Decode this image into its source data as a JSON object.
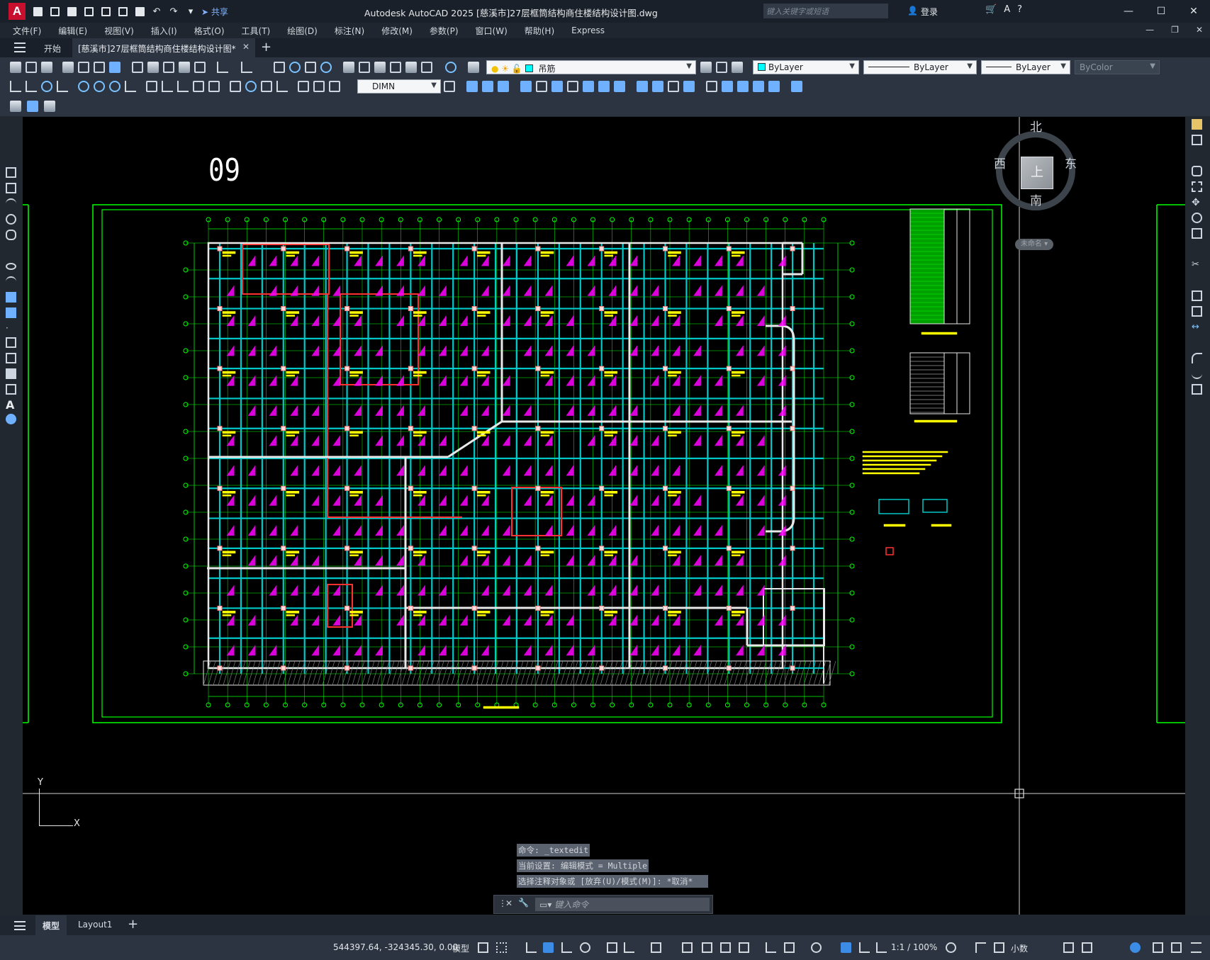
{
  "app": {
    "logo": "A",
    "title": "Autodesk AutoCAD 2025    [慈溪市]27层框筒结构商住楼结构设计图.dwg",
    "search_placeholder": "键入关键字或短语",
    "login": "登录",
    "share": "共享"
  },
  "menu": [
    "文件(F)",
    "编辑(E)",
    "视图(V)",
    "插入(I)",
    "格式(O)",
    "工具(T)",
    "绘图(D)",
    "标注(N)",
    "修改(M)",
    "参数(P)",
    "窗口(W)",
    "帮助(H)",
    "Express"
  ],
  "tabs": {
    "start": "开始",
    "document": "[慈溪市]27层框筒结构商住楼结构设计图*"
  },
  "toolbar": {
    "layer_name": "吊筋",
    "color": "ByLayer",
    "linetype": "ByLayer",
    "lineweight": "ByLayer",
    "plotstyle": "ByColor",
    "dimstyle": "DIMN"
  },
  "drawing": {
    "page_number": "09"
  },
  "viewcube": {
    "north": "北",
    "south": "南",
    "east": "东",
    "west": "西",
    "top": "上",
    "ucs_label": "未命名"
  },
  "ucs": {
    "x": "X",
    "y": "Y"
  },
  "command": {
    "history": [
      "命令: _textedit",
      "当前设置: 编辑模式 = Multiple",
      "选择注释对象或 [放弃(U)/模式(M)]: *取消*"
    ],
    "placeholder": "键入命令"
  },
  "layout_tabs": [
    "模型",
    "Layout1"
  ],
  "status": {
    "coordinates": "544397.64, -324345.30, 0.00",
    "model": "模型",
    "annotation_scale": "1:1 / 100%",
    "units": "小数"
  },
  "colors": {
    "canvas_bg": "#000000",
    "beam": "#00c8c8",
    "wall": "#e8e8e8",
    "grid": "#00ff00",
    "red_frame": "#ff3030",
    "annotation": "#ff00ff",
    "text_yellow": "#ffff00"
  }
}
